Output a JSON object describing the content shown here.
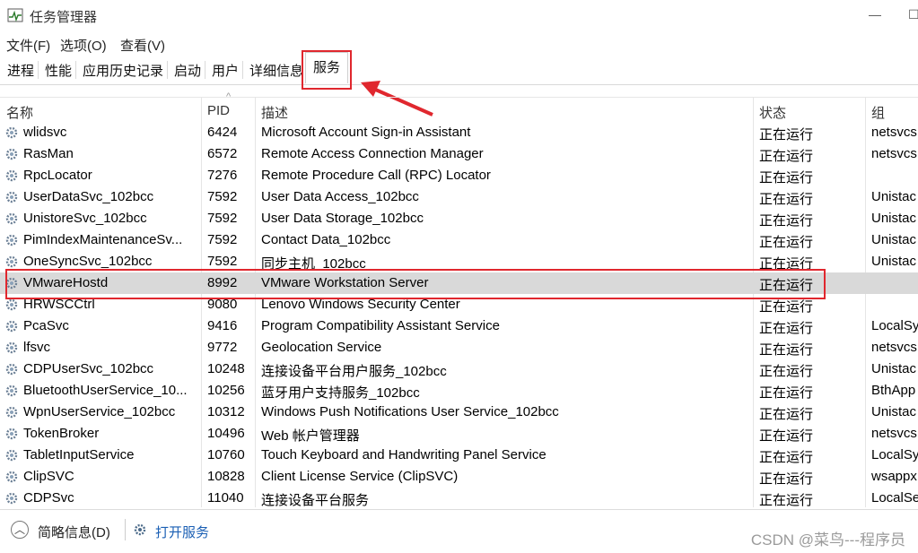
{
  "window": {
    "title": "任务管理器",
    "icon": "task-manager-icon"
  },
  "menu": [
    "文件(F)",
    "选项(O)",
    "查看(V)"
  ],
  "tabs": [
    "进程",
    "性能",
    "应用历史记录",
    "启动",
    "用户",
    "详细信息",
    "服务"
  ],
  "active_tab": "服务",
  "columns": {
    "name": "名称",
    "pid": "PID",
    "desc": "描述",
    "status": "状态",
    "group": "组"
  },
  "rows": [
    {
      "name": "wlidsvc",
      "pid": "6424",
      "desc": "Microsoft Account Sign-in Assistant",
      "status": "正在运行",
      "group": "netsvcs"
    },
    {
      "name": "RasMan",
      "pid": "6572",
      "desc": "Remote Access Connection Manager",
      "status": "正在运行",
      "group": "netsvcs"
    },
    {
      "name": "RpcLocator",
      "pid": "7276",
      "desc": "Remote Procedure Call (RPC) Locator",
      "status": "正在运行",
      "group": ""
    },
    {
      "name": "UserDataSvc_102bcc",
      "pid": "7592",
      "desc": "User Data Access_102bcc",
      "status": "正在运行",
      "group": "Unistac"
    },
    {
      "name": "UnistoreSvc_102bcc",
      "pid": "7592",
      "desc": "User Data Storage_102bcc",
      "status": "正在运行",
      "group": "Unistac"
    },
    {
      "name": "PimIndexMaintenanceSv...",
      "pid": "7592",
      "desc": "Contact Data_102bcc",
      "status": "正在运行",
      "group": "Unistac"
    },
    {
      "name": "OneSyncSvc_102bcc",
      "pid": "7592",
      "desc": "同步主机_102bcc",
      "status": "正在运行",
      "group": "Unistac"
    },
    {
      "name": "VMwareHostd",
      "pid": "8992",
      "desc": "VMware Workstation Server",
      "status": "正在运行",
      "group": ""
    },
    {
      "name": "HRWSCCtrl",
      "pid": "9080",
      "desc": "Lenovo Windows Security Center",
      "status": "正在运行",
      "group": ""
    },
    {
      "name": "PcaSvc",
      "pid": "9416",
      "desc": "Program Compatibility Assistant Service",
      "status": "正在运行",
      "group": "LocalSy"
    },
    {
      "name": "lfsvc",
      "pid": "9772",
      "desc": "Geolocation Service",
      "status": "正在运行",
      "group": "netsvcs"
    },
    {
      "name": "CDPUserSvc_102bcc",
      "pid": "10248",
      "desc": "连接设备平台用户服务_102bcc",
      "status": "正在运行",
      "group": "Unistac"
    },
    {
      "name": "BluetoothUserService_10...",
      "pid": "10256",
      "desc": "蓝牙用户支持服务_102bcc",
      "status": "正在运行",
      "group": "BthApp"
    },
    {
      "name": "WpnUserService_102bcc",
      "pid": "10312",
      "desc": "Windows Push Notifications User Service_102bcc",
      "status": "正在运行",
      "group": "Unistac"
    },
    {
      "name": "TokenBroker",
      "pid": "10496",
      "desc": "Web 帐户管理器",
      "status": "正在运行",
      "group": "netsvcs"
    },
    {
      "name": "TabletInputService",
      "pid": "10760",
      "desc": "Touch Keyboard and Handwriting Panel Service",
      "status": "正在运行",
      "group": "LocalSy"
    },
    {
      "name": "ClipSVC",
      "pid": "10828",
      "desc": "Client License Service (ClipSVC)",
      "status": "正在运行",
      "group": "wsappx"
    },
    {
      "name": "CDPSvc",
      "pid": "11040",
      "desc": "连接设备平台服务",
      "status": "正在运行",
      "group": "LocalSe"
    }
  ],
  "selected_row": "VMwareHostd",
  "footer": {
    "less_details": "简略信息(D)",
    "open_services": "打开服务"
  },
  "watermark": "CSDN @菜鸟---程序员",
  "colors": {
    "highlight": "#e0272e",
    "selected_row": "#d9d9d9",
    "link": "#1a5fb4"
  }
}
